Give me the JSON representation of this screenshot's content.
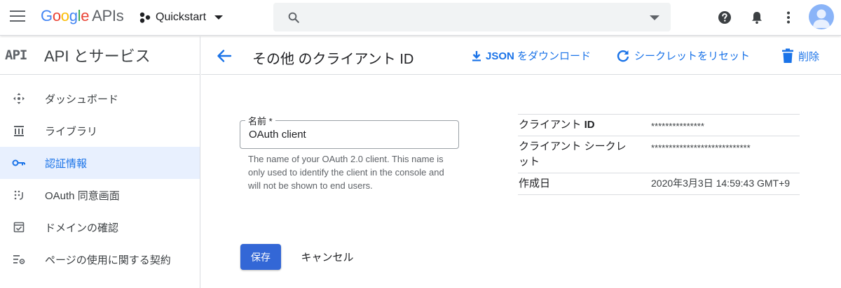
{
  "topbar": {
    "brand_google": [
      "G",
      "o",
      "o",
      "g",
      "l",
      "e"
    ],
    "brand_apis": "APIs",
    "project_name": "Quickstart",
    "search_placeholder": ""
  },
  "sidebar": {
    "badge": "API",
    "title": "API とサービス",
    "items": [
      {
        "label": "ダッシュボード",
        "icon": "dashboard-icon"
      },
      {
        "label": "ライブラリ",
        "icon": "library-icon"
      },
      {
        "label": "認証情報",
        "icon": "key-icon",
        "active": true
      },
      {
        "label": "OAuth 同意画面",
        "icon": "consent-screen-icon"
      },
      {
        "label": "ドメインの確認",
        "icon": "domain-verification-icon"
      },
      {
        "label": "ページの使用に関する契約",
        "icon": "page-usage-agreements-icon"
      }
    ]
  },
  "header": {
    "title": "その他 のクライアント ID",
    "download_json_bold": "JSON",
    "download_json_rest": " をダウンロード",
    "reset_secret": "シークレットをリセット",
    "delete": "削除"
  },
  "form": {
    "name_label": "名前 *",
    "name_value": "OAuth client",
    "helper": "The name of your OAuth 2.0 client. This name is only used to identify the client in the console and will not be shown to end users."
  },
  "info": {
    "rows": [
      {
        "key_prefix": "クライアント ",
        "key_bold": "ID",
        "value": "***************"
      },
      {
        "key_prefix": "クライアント シークレット",
        "key_bold": "",
        "value": "****************************"
      },
      {
        "key_prefix": "作成日",
        "key_bold": "",
        "value": "2020年3月3日 14:59:43 GMT+9"
      }
    ]
  },
  "buttons": {
    "save": "保存",
    "cancel": "キャンセル"
  },
  "colors": {
    "accent": "#1a73e8",
    "primary_button": "#3367d6",
    "active_nav_bg": "#e8f0fe"
  }
}
